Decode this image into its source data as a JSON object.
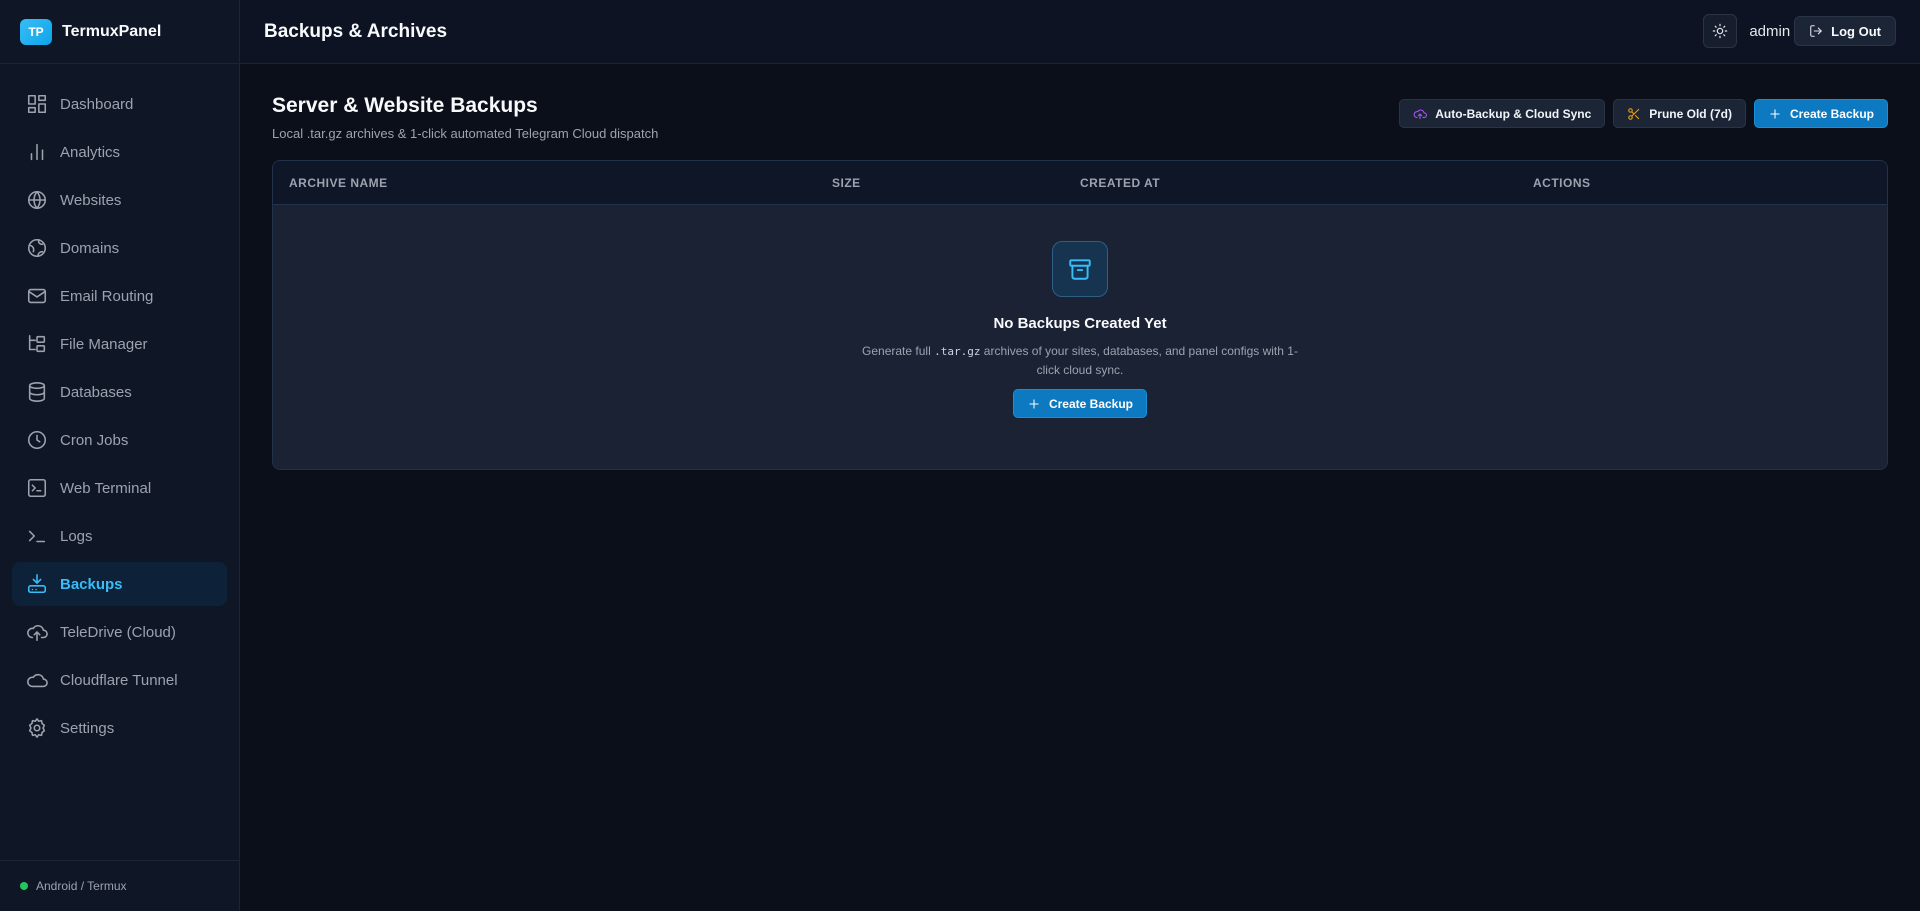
{
  "brand": {
    "logo_text": "TP",
    "name": "TermuxPanel"
  },
  "sidebar": {
    "items": [
      {
        "label": "Dashboard",
        "icon": "dashboard-icon"
      },
      {
        "label": "Analytics",
        "icon": "analytics-icon"
      },
      {
        "label": "Websites",
        "icon": "globe-icon"
      },
      {
        "label": "Domains",
        "icon": "domain-globe-icon"
      },
      {
        "label": "Email Routing",
        "icon": "mail-icon"
      },
      {
        "label": "File Manager",
        "icon": "folder-tree-icon"
      },
      {
        "label": "Databases",
        "icon": "database-icon"
      },
      {
        "label": "Cron Jobs",
        "icon": "clock-icon"
      },
      {
        "label": "Web Terminal",
        "icon": "terminal-square-icon"
      },
      {
        "label": "Logs",
        "icon": "terminal-prompt-icon"
      },
      {
        "label": "Backups",
        "icon": "hard-drive-download-icon",
        "active": true
      },
      {
        "label": "TeleDrive (Cloud)",
        "icon": "cloud-upload-icon"
      },
      {
        "label": "Cloudflare Tunnel",
        "icon": "cloud-icon"
      },
      {
        "label": "Settings",
        "icon": "gear-icon"
      }
    ],
    "footer": "Android / Termux"
  },
  "topbar": {
    "title": "Backups & Archives",
    "user": "admin",
    "logout_label": "Log Out"
  },
  "main": {
    "title": "Server & Website Backups",
    "subtitle": "Local .tar.gz archives & 1-click automated Telegram Cloud dispatch",
    "actions": {
      "auto_backup": "Auto-Backup & Cloud Sync",
      "prune": "Prune Old (7d)",
      "create": "Create Backup"
    },
    "table": {
      "columns": [
        "ARCHIVE NAME",
        "SIZE",
        "CREATED AT",
        "ACTIONS"
      ],
      "empty": {
        "title": "No Backups Created Yet",
        "desc_before": "Generate full ",
        "desc_code": ".tar.gz",
        "desc_after": " archives of your sites, databases, and panel configs with 1-click cloud sync.",
        "button": "Create Backup"
      }
    }
  },
  "colors": {
    "accent": "#38bdf8",
    "primary_button": "#0c79c0",
    "status_online": "#22c55e",
    "auto_backup_icon": "#a855f7",
    "prune_icon": "#f59e0b"
  }
}
